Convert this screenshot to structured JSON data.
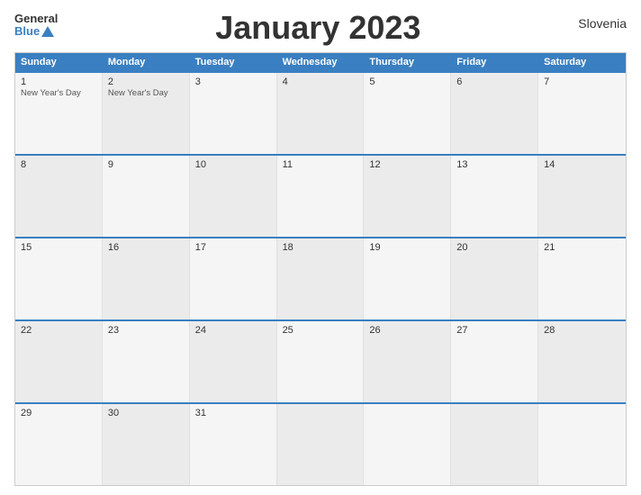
{
  "header": {
    "logo_general": "General",
    "logo_blue": "Blue",
    "title": "January 2023",
    "country": "Slovenia"
  },
  "calendar": {
    "days_of_week": [
      "Sunday",
      "Monday",
      "Tuesday",
      "Wednesday",
      "Thursday",
      "Friday",
      "Saturday"
    ],
    "weeks": [
      [
        {
          "day": "1",
          "holiday": "New Year's Day"
        },
        {
          "day": "2",
          "holiday": "New Year's Day"
        },
        {
          "day": "3",
          "holiday": ""
        },
        {
          "day": "4",
          "holiday": ""
        },
        {
          "day": "5",
          "holiday": ""
        },
        {
          "day": "6",
          "holiday": ""
        },
        {
          "day": "7",
          "holiday": ""
        }
      ],
      [
        {
          "day": "8",
          "holiday": ""
        },
        {
          "day": "9",
          "holiday": ""
        },
        {
          "day": "10",
          "holiday": ""
        },
        {
          "day": "11",
          "holiday": ""
        },
        {
          "day": "12",
          "holiday": ""
        },
        {
          "day": "13",
          "holiday": ""
        },
        {
          "day": "14",
          "holiday": ""
        }
      ],
      [
        {
          "day": "15",
          "holiday": ""
        },
        {
          "day": "16",
          "holiday": ""
        },
        {
          "day": "17",
          "holiday": ""
        },
        {
          "day": "18",
          "holiday": ""
        },
        {
          "day": "19",
          "holiday": ""
        },
        {
          "day": "20",
          "holiday": ""
        },
        {
          "day": "21",
          "holiday": ""
        }
      ],
      [
        {
          "day": "22",
          "holiday": ""
        },
        {
          "day": "23",
          "holiday": ""
        },
        {
          "day": "24",
          "holiday": ""
        },
        {
          "day": "25",
          "holiday": ""
        },
        {
          "day": "26",
          "holiday": ""
        },
        {
          "day": "27",
          "holiday": ""
        },
        {
          "day": "28",
          "holiday": ""
        }
      ],
      [
        {
          "day": "29",
          "holiday": ""
        },
        {
          "day": "30",
          "holiday": ""
        },
        {
          "day": "31",
          "holiday": ""
        },
        {
          "day": "",
          "holiday": ""
        },
        {
          "day": "",
          "holiday": ""
        },
        {
          "day": "",
          "holiday": ""
        },
        {
          "day": "",
          "holiday": ""
        }
      ]
    ]
  }
}
